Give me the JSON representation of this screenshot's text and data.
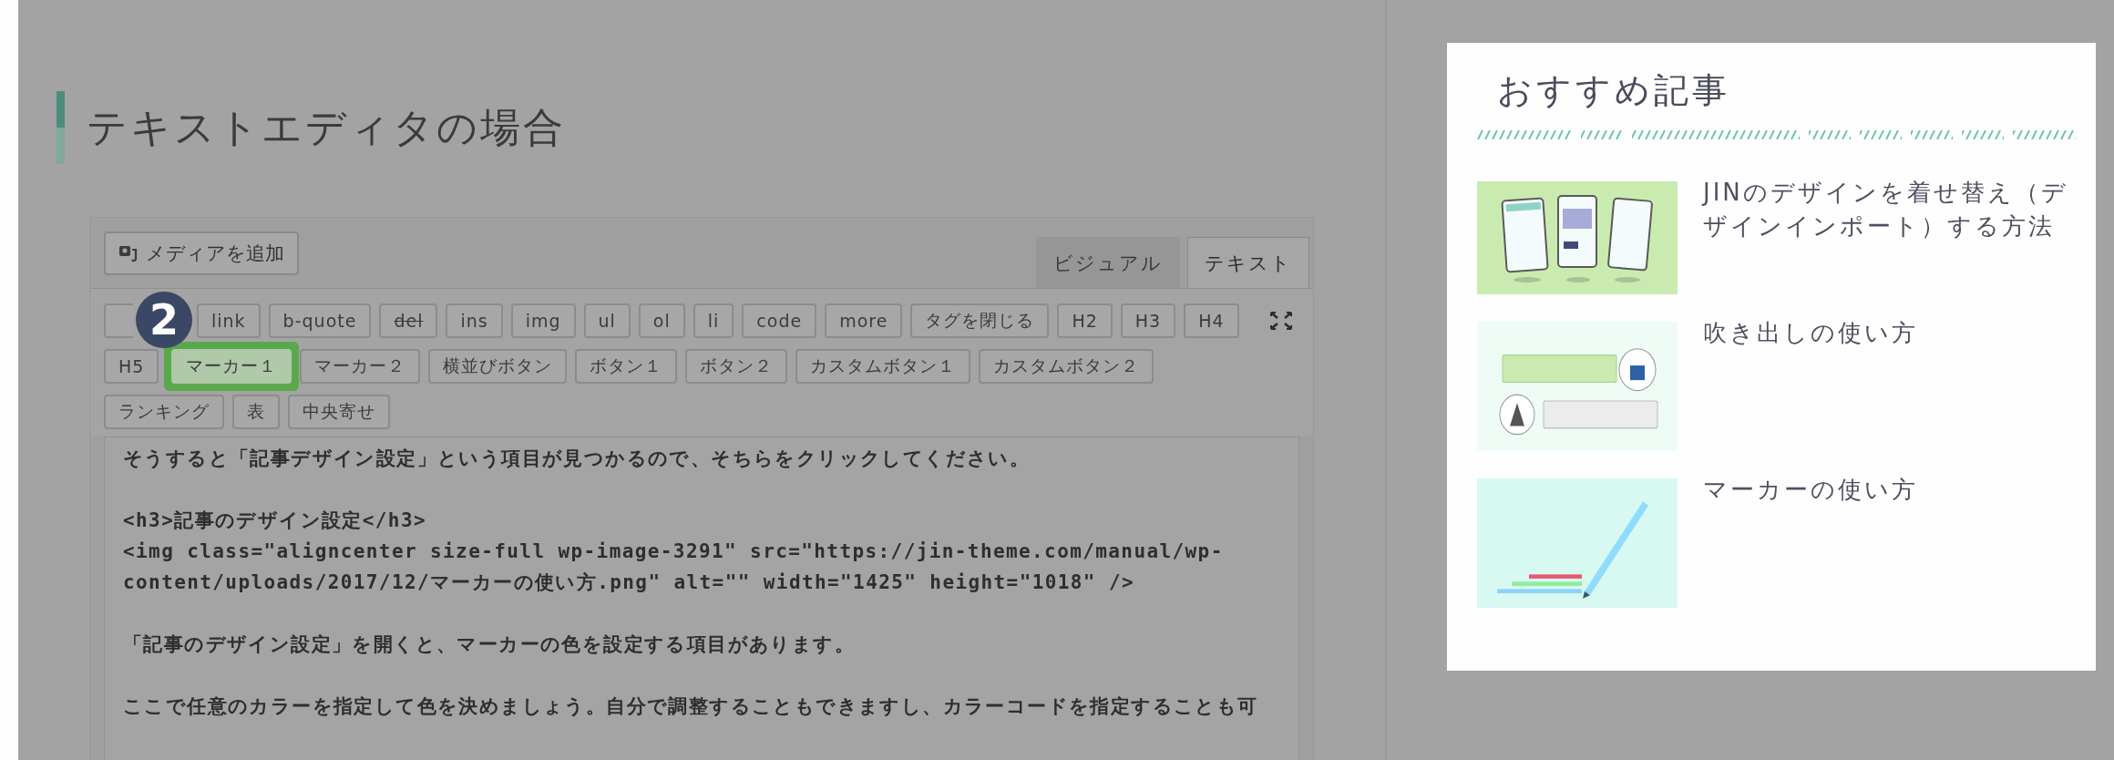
{
  "article": {
    "heading": "テキストエディタの場合",
    "editor": {
      "media_button": "メディアを追加",
      "tabs": [
        {
          "label": "ビジュアル",
          "selected": false
        },
        {
          "label": "テキスト",
          "selected": true
        }
      ],
      "step_badge": "2",
      "toolbar_rows": [
        [
          {
            "kind": "covered"
          },
          {
            "label": "link",
            "kind": "plain",
            "highlighted": false
          },
          {
            "label": "b-quote",
            "kind": "plain",
            "highlighted": false
          },
          {
            "label": "del",
            "kind": "strike",
            "highlighted": false
          },
          {
            "label": "ins",
            "kind": "plain",
            "highlighted": false
          },
          {
            "label": "img",
            "kind": "plain",
            "highlighted": false
          },
          {
            "label": "ul",
            "kind": "plain",
            "highlighted": false
          },
          {
            "label": "ol",
            "kind": "plain",
            "highlighted": false
          },
          {
            "label": "li",
            "kind": "plain",
            "highlighted": false
          },
          {
            "label": "code",
            "kind": "plain",
            "highlighted": false
          },
          {
            "label": "more",
            "kind": "plain",
            "highlighted": false
          },
          {
            "label": "タグを閉じる",
            "kind": "plain",
            "highlighted": false
          },
          {
            "label": "H2",
            "kind": "plain",
            "highlighted": false
          },
          {
            "label": "H3",
            "kind": "plain",
            "highlighted": false
          },
          {
            "label": "H4",
            "kind": "plain",
            "highlighted": false
          }
        ],
        [
          {
            "label": "H5",
            "kind": "plain",
            "highlighted": false
          },
          {
            "label": "マーカー１",
            "kind": "plain",
            "highlighted": true
          },
          {
            "label": "マーカー２",
            "kind": "plain",
            "highlighted": false
          },
          {
            "label": "横並びボタン",
            "kind": "plain",
            "highlighted": false
          },
          {
            "label": "ボタン１",
            "kind": "plain",
            "highlighted": false
          },
          {
            "label": "ボタン２",
            "kind": "plain",
            "highlighted": false
          },
          {
            "label": "カスタムボタン１",
            "kind": "plain",
            "highlighted": false
          },
          {
            "label": "カスタムボタン２",
            "kind": "plain",
            "highlighted": false
          }
        ],
        [
          {
            "label": "ランキング",
            "kind": "plain",
            "highlighted": false
          },
          {
            "label": "表",
            "kind": "plain",
            "highlighted": false
          },
          {
            "label": "中央寄せ",
            "kind": "plain",
            "highlighted": false
          }
        ]
      ],
      "paragraphs": [
        [
          "そうすると「記事デザイン設定」という項目が見つかるので、そちらをクリックしてください。"
        ],
        [
          "<h3>記事のデザイン設定</h3>",
          "<img class=\"aligncenter size-full wp-image-3291\" src=\"https://jin-theme.com/manual/wp-",
          "content/uploads/2017/12/マーカーの使い方.png\" alt=\"\" width=\"1425\" height=\"1018\" />"
        ],
        [
          "「記事のデザイン設定」を開くと、マーカーの色を設定する項目があります。"
        ],
        [
          "ここで任意のカラーを指定して色を決めましょう。自分で調整することもできますし、カラーコードを指定することも可"
        ]
      ]
    }
  },
  "sidebar": {
    "title": "おすすめ記事",
    "articles": [
      {
        "title": "JINのデザインを着せ替え（デザインインポート）する方法",
        "kind": "picture"
      },
      {
        "title": "吹き出しの使い方",
        "kind": "picture"
      },
      {
        "title": "マーカーの使い方",
        "kind": "picture"
      }
    ]
  }
}
